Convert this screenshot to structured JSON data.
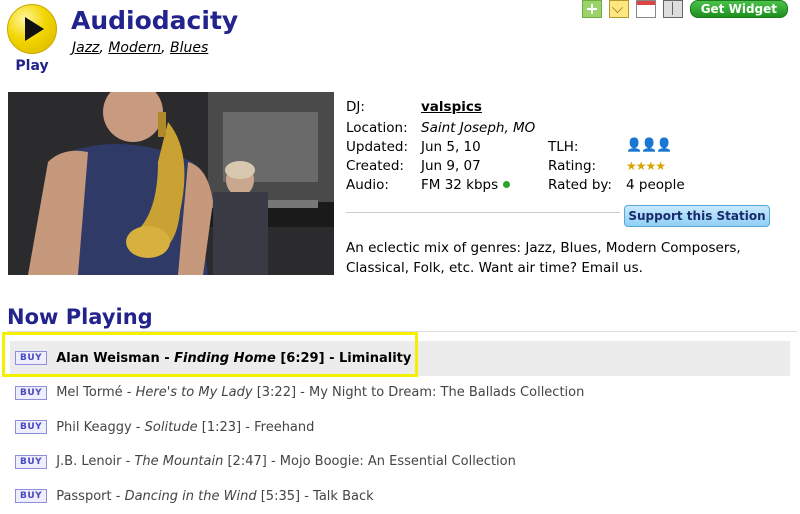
{
  "play": {
    "label": "Play"
  },
  "station": {
    "title": "Audiodacity",
    "genres": [
      "Jazz",
      "Modern",
      "Blues"
    ]
  },
  "toolbar": {
    "widget_label": "Get Widget"
  },
  "info": {
    "dj_label": "DJ:",
    "dj": "valspics",
    "location_label": "Location:",
    "location": "Saint Joseph, MO",
    "updated_label": "Updated:",
    "updated": "Jun 5, 10",
    "created_label": "Created:",
    "created": "Jun 9, 07",
    "audio_label": "Audio:",
    "audio": "FM 32 kbps",
    "tlh_label": "TLH:",
    "tlh_icons": "👤👤👤",
    "rating_label": "Rating:",
    "rating_stars": "★★★★",
    "rated_by_label": "Rated by:",
    "rated_by": "4 people"
  },
  "support_label": "Support this Station",
  "description": "An eclectic mix of genres: Jazz, Blues, Modern Composers, Classical, Folk, etc. Want air time? Email us.",
  "now_playing": {
    "title": "Now Playing",
    "buy_label": "BUY",
    "tracks": [
      {
        "artist": "Alan Weisman",
        "song": "Finding Home",
        "duration": "[6:29]",
        "album": "Liminality"
      },
      {
        "artist": "Mel Tormé",
        "song": "Here's to My Lady",
        "duration": "[3:22]",
        "album": "My Night to Dream: The Ballads Collection"
      },
      {
        "artist": "Phil Keaggy",
        "song": "Solitude",
        "duration": "[1:23]",
        "album": "Freehand"
      },
      {
        "artist": "J.B. Lenoir",
        "song": "The Mountain",
        "duration": "[2:47]",
        "album": "Mojo Boogie: An Essential Collection"
      },
      {
        "artist": "Passport",
        "song": "Dancing in the Wind",
        "duration": "[5:35]",
        "album": "Talk Back"
      }
    ]
  },
  "colors": {
    "accent": "#23238e",
    "play": "#f2d600",
    "live_dot": "#2aa52a"
  }
}
